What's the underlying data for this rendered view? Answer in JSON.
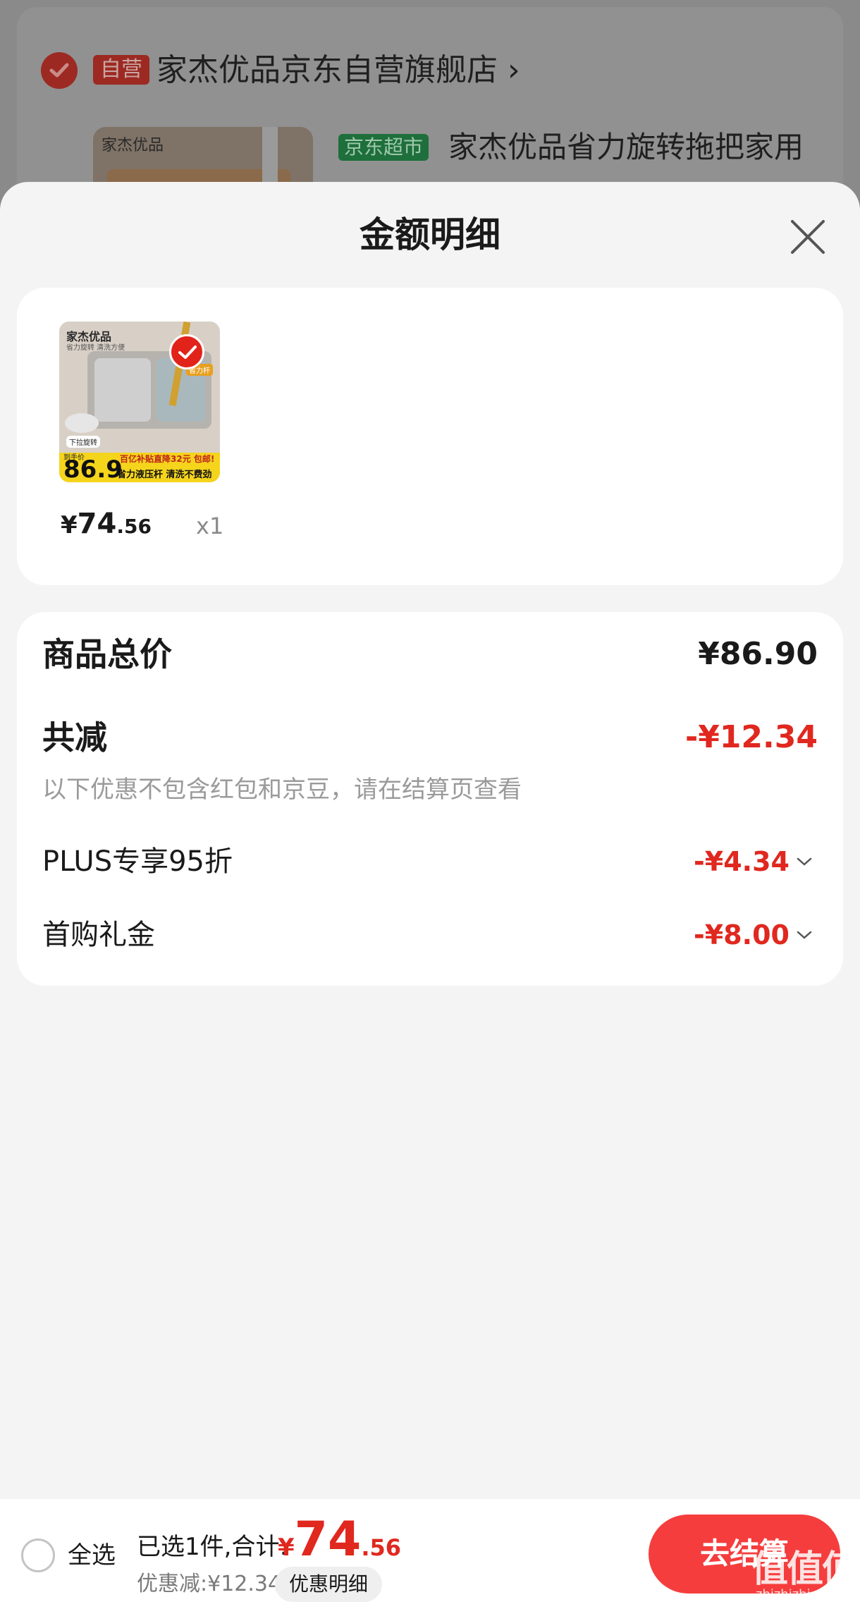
{
  "background": {
    "store_tag": "自营",
    "store_name": "家杰优品京东自营旗舰店 ›",
    "product_brand": "家杰优品",
    "channel_tag": "京东超市",
    "product_title": "家杰优品省力旋转拖把家用"
  },
  "sheet": {
    "title": "金额明细",
    "close_icon": "close-icon"
  },
  "product": {
    "image": {
      "brand": "家杰优品",
      "brand_sub": "省力旋转 清洗方便",
      "side_label": "下拉旋转",
      "tag": "省力杆",
      "price_label": "到手价",
      "price": "86.9",
      "banner_line1": "百亿补贴直降32元 包邮!",
      "banner_line2": "省力液压杆 清洗不费劲"
    },
    "price_symbol": "¥",
    "price_int": "74",
    "price_dec": ".56",
    "quantity": "x1"
  },
  "summary": {
    "total_label": "商品总价",
    "total_value": "¥86.90",
    "discount_label": "共减",
    "discount_value": "-¥12.34",
    "note": "以下优惠不包含红包和京豆，请在结算页查看",
    "items": [
      {
        "label": "PLUS专享95折",
        "value": "-¥4.34"
      },
      {
        "label": "首购礼金",
        "value": "-¥8.00"
      }
    ]
  },
  "bottom_bar": {
    "select_all": "全选",
    "selected": "已选1件,合计:",
    "total_symbol": "¥",
    "total_int": "74",
    "total_dec": ".56",
    "saved": "优惠减:¥12.34",
    "detail_button": "优惠明细",
    "checkout_button": "去结算"
  },
  "watermark": {
    "main": "值值值",
    "sub": "zhizhizhi.com"
  },
  "colors": {
    "accent": "#e0281f",
    "checkout": "#f53d3d",
    "jd_green": "#1e6f3b"
  }
}
